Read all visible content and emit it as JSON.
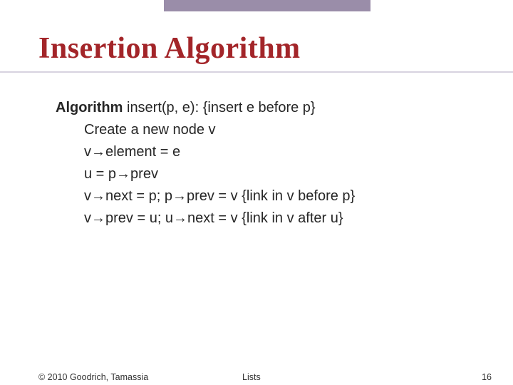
{
  "title": "Insertion Algorithm",
  "body": {
    "line0_bold": "Algorithm",
    "line0_rest": " insert(p, e): {insert e before p}",
    "line1": "Create a new node v",
    "line2": "v→element = e",
    "line3": "u = p→prev",
    "line4": "v→next = p;  p→prev = v  {link in v before p}",
    "line5": "v→prev = u;  u→next = v  {link in v after u}"
  },
  "footer": {
    "copyright": "© 2010 Goodrich, Tamassia",
    "center": "Lists",
    "page": "16"
  }
}
